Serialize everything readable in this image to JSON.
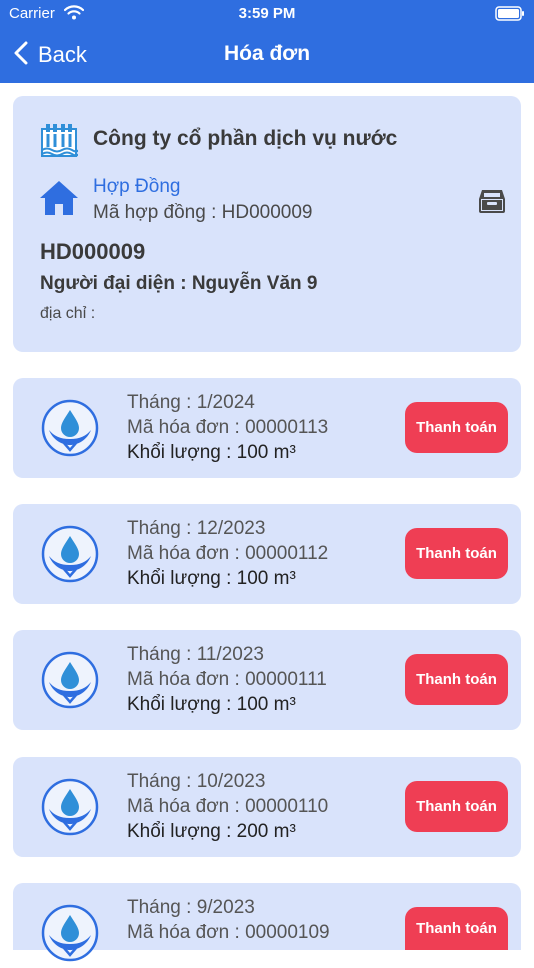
{
  "status_bar": {
    "carrier": "Carrier",
    "time": "3:59 PM"
  },
  "nav": {
    "back_label": "Back",
    "title": "Hóa đơn"
  },
  "contract": {
    "company_name": "Công ty cổ phần dịch vụ nước",
    "contract_link": "Hợp Đồng",
    "contract_code_line": "Mã hợp đồng : HD000009",
    "contract_id": "HD000009",
    "representative": "Người đại diện : Nguyễn Văn 9",
    "address": "địa chỉ :"
  },
  "bills": [
    {
      "month": "Tháng : 1/2024",
      "code": "Mã hóa đơn : 00000113",
      "volume": "Khổi lượng : 100 m³",
      "pay_label": "Thanh toán"
    },
    {
      "month": "Tháng : 12/2023",
      "code": "Mã hóa đơn : 00000112",
      "volume": "Khổi lượng : 100 m³",
      "pay_label": "Thanh toán"
    },
    {
      "month": "Tháng : 11/2023",
      "code": "Mã hóa đơn : 00000111",
      "volume": "Khổi lượng : 100 m³",
      "pay_label": "Thanh toán"
    },
    {
      "month": "Tháng : 10/2023",
      "code": "Mã hóa đơn : 00000110",
      "volume": "Khổi lượng : 200 m³",
      "pay_label": "Thanh toán"
    },
    {
      "month": "Tháng : 9/2023",
      "code": "Mã hóa đơn : 00000109",
      "volume": "",
      "pay_label": "Thanh toán"
    }
  ],
  "icons": {
    "back": "chevron-left-icon",
    "company": "water-plant-icon",
    "contract": "home-icon",
    "archive": "archive-box-icon",
    "bill": "water-drop-hands-icon"
  },
  "colors": {
    "header": "#2f6ee0",
    "card": "#d9e3fb",
    "pay_button": "#ef3e54",
    "link": "#2f6ee0"
  }
}
